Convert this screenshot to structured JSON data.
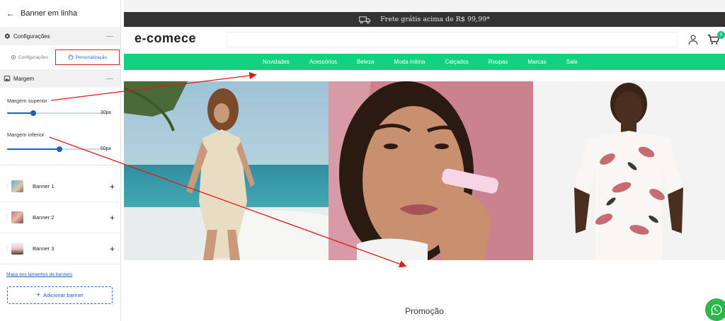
{
  "sidebar": {
    "title": "Banner em linha",
    "config_section": "Configurações",
    "tabs": [
      {
        "label": "Configurações"
      },
      {
        "label": "Personalização"
      }
    ],
    "margin_section": "Margem",
    "sliders": [
      {
        "label": "Margem superior",
        "value": "30px",
        "fraction": 0.25
      },
      {
        "label": "Margem inferior",
        "value": "60px",
        "fraction": 0.5
      }
    ],
    "banners": [
      {
        "label": "Banner 1"
      },
      {
        "label": "Banner 2"
      },
      {
        "label": "Banner 3"
      }
    ],
    "map_link": "Mapa dos tamanhos de banners",
    "add_button": "Adicionar banner"
  },
  "store": {
    "promo_text": "Frete grátis acima de R$ 99,99*",
    "logo": "e-comece",
    "cart_count": "0",
    "menu": [
      "Novidades",
      "Acessórios",
      "Beleza",
      "Moda íntima",
      "Calçados",
      "Roupas",
      "Marcas",
      "Sale"
    ],
    "section_title": "Promoção",
    "accent_color": "#12d181"
  }
}
